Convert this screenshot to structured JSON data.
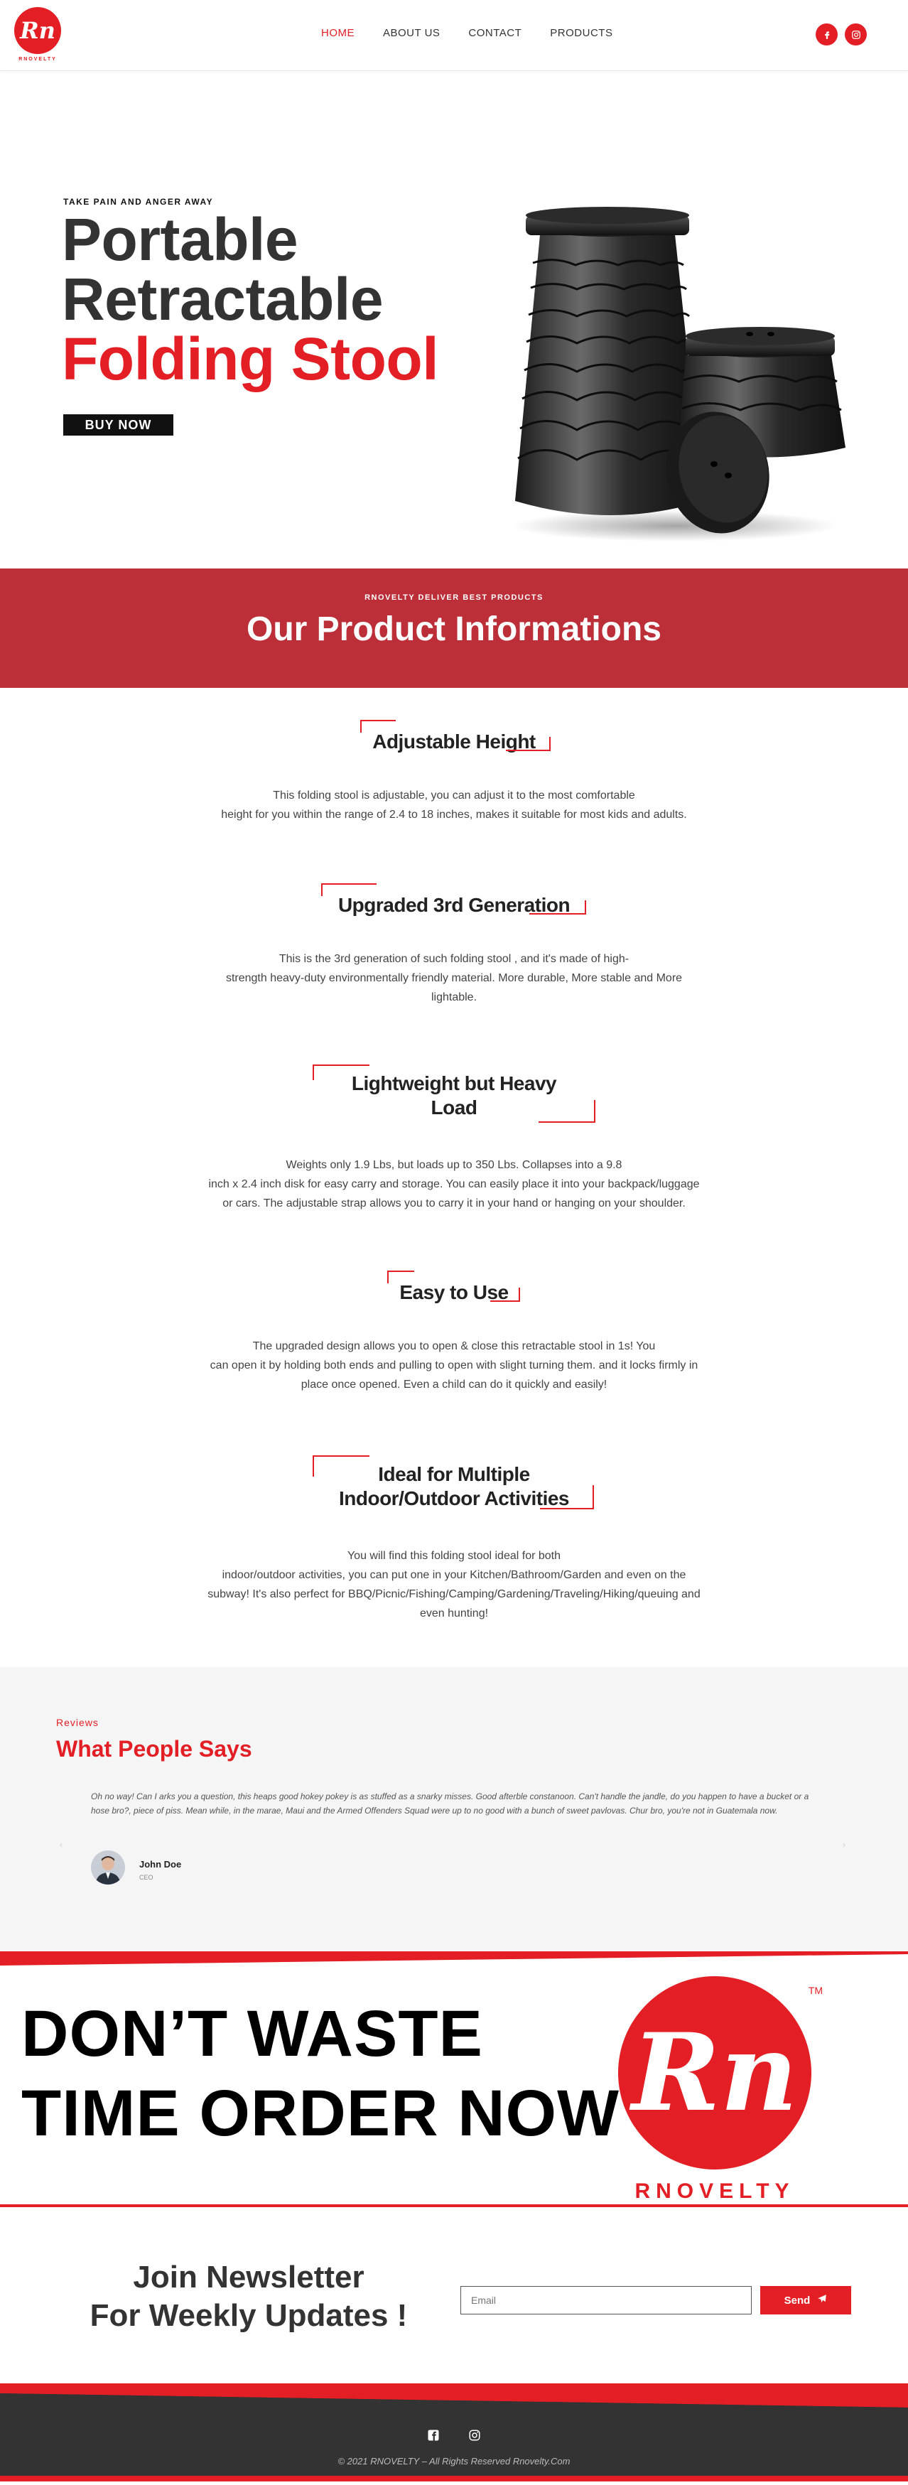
{
  "header": {
    "logo_text": "Rn",
    "logo_word": "RNOVELTY",
    "nav": [
      {
        "label": "HOME",
        "active": true
      },
      {
        "label": "ABOUT US",
        "active": false
      },
      {
        "label": "CONTACT",
        "active": false
      },
      {
        "label": "PRODUCTS",
        "active": false
      }
    ],
    "social": [
      {
        "icon": "facebook-icon"
      },
      {
        "icon": "instagram-icon"
      }
    ]
  },
  "hero": {
    "kicker": "TAKE PAIN AND ANGER AWAY",
    "title_line1": "Portable",
    "title_line2": "Retractable",
    "title_line3": "Folding Stool",
    "cta_label": "BUY NOW"
  },
  "banner": {
    "small": "RNOVELTY DELIVER BEST PRODUCTS",
    "title": "Our Product Informations"
  },
  "features": [
    {
      "title": "Adjustable Height",
      "text_lines": [
        "This folding stool is adjustable, you can adjust it to the most comfortable",
        "height for you within the range of 2.4 to 18 inches, makes it suitable for most kids and adults."
      ]
    },
    {
      "title": "Upgraded 3rd Generation",
      "text_lines": [
        "This is the 3rd generation of such folding stool , and it's made of high-",
        "strength heavy-duty environmentally friendly material. More durable, More stable and More",
        "lightable."
      ]
    },
    {
      "title_lines": [
        "Lightweight but Heavy",
        "Load"
      ],
      "text_lines": [
        "Weights only 1.9 Lbs, but loads up to 350 Lbs. Collapses into a 9.8",
        "inch x 2.4 inch disk for easy carry and storage. You can easily place it into your backpack/luggage",
        "or cars. The adjustable strap allows you to carry it in your hand or hanging on your shoulder."
      ]
    },
    {
      "title": "Easy to Use",
      "text_lines": [
        "The upgraded design allows you to open & close this retractable stool in 1s! You",
        "can open it by holding both ends and pulling to open with slight turning them. and it locks firmly in",
        "place once opened. Even a child can do it quickly and easily!"
      ]
    },
    {
      "title_lines": [
        "Ideal for Multiple",
        "Indoor/Outdoor Activities"
      ],
      "text_lines": [
        "You will find this folding stool ideal for both",
        "indoor/outdoor activities, you can put one in your Kitchen/Bathroom/Garden and even on the",
        "subway! It's also perfect for BBQ/Picnic/Fishing/Camping/Gardening/Traveling/Hiking/queuing and",
        "even hunting!"
      ]
    }
  ],
  "reviews": {
    "label": "Reviews",
    "title": "What People Says",
    "quote": "Oh no way! Can I arks you a question, this heaps good hokey pokey is as stuffed as a snarky misses. Good afterble constanoon. Can't handle the jandle, do you happen to have a bucket or a hose bro?, piece of piss. Mean while, in the marae, Maui and the Armed Offenders Squad were up to no good with a bunch of sweet pavlovas. Chur bro, you're not in Guatemala now.",
    "name": "John Doe",
    "role": "CEO"
  },
  "cta": {
    "line1": "DON’T WASTE",
    "line2": "TIME ORDER NOW",
    "logo_text": "Rn",
    "logo_word": "RNOVELTY",
    "tm": "TM"
  },
  "newsletter": {
    "title_line1": "Join Newsletter",
    "title_line2": "For Weekly Updates !",
    "placeholder": "Email",
    "button": "Send"
  },
  "footer": {
    "icons": [
      "facebook-square-icon",
      "instagram-icon"
    ],
    "copyright": "© 2021 RNOVELTY – All Rights Reserved Rnovelty.Com"
  },
  "colors": {
    "brand_red": "#e31e24",
    "banner_red": "#bd2f38",
    "dark": "#333333"
  }
}
